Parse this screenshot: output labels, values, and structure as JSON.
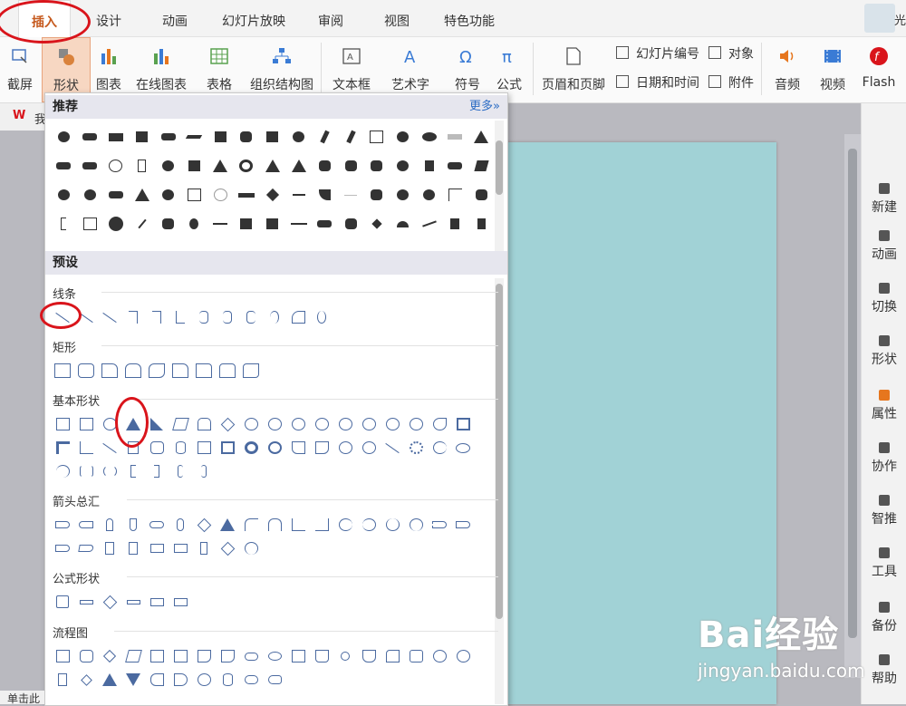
{
  "tabs": [
    "插入",
    "设计",
    "动画",
    "幻灯片放映",
    "审阅",
    "视图",
    "特色功能"
  ],
  "active_tab": "插入",
  "user_text": "光",
  "ribbon": {
    "screenshot": "截屏",
    "shape": "形状",
    "chart": "图表",
    "online_chart": "在线图表",
    "table": "表格",
    "org_chart": "组织结构图",
    "textbox": "文本框",
    "wordart": "艺术字",
    "symbol": "符号",
    "formula": "公式",
    "header_footer": "页眉和页脚",
    "slide_number": "幻灯片编号",
    "object": "对象",
    "date_time": "日期和时间",
    "attachment": "附件",
    "audio": "音频",
    "video": "视频",
    "flash": "Flash"
  },
  "doc_tab_text": "我",
  "panel": {
    "recommended": "推荐",
    "more": "更多»",
    "preset": "预设",
    "categories": [
      "线条",
      "矩形",
      "基本形状",
      "箭头总汇",
      "公式形状",
      "流程图"
    ]
  },
  "right_panel": [
    "新建",
    "动画",
    "切换",
    "形状",
    "属性",
    "协作",
    "智推",
    "工具",
    "备份",
    "帮助"
  ],
  "status_text": "单击此",
  "watermark": {
    "logo": "Bai经验",
    "url": "jingyan.baidu.com"
  }
}
